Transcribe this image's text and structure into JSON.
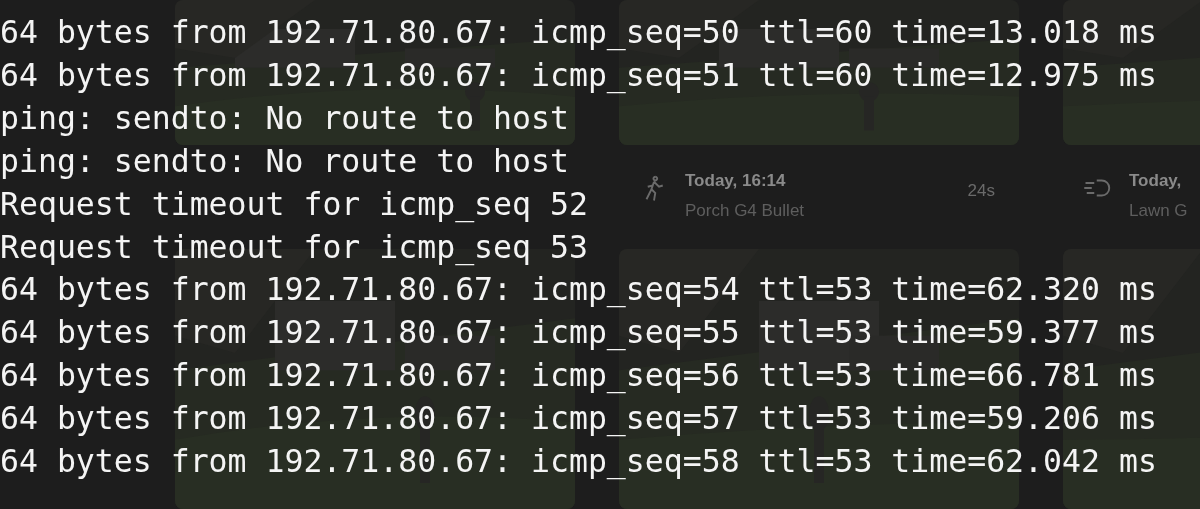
{
  "backdrop": {
    "cards": [
      {
        "kind": "picture"
      },
      {
        "kind": "person",
        "time": "Today, 16:14",
        "camera": "Porch G4 Bullet",
        "duration": "24s"
      },
      {
        "kind": "motion",
        "time": "Today,",
        "camera": "Lawn G"
      }
    ]
  },
  "terminal": {
    "lines": [
      "64 bytes from 192.71.80.67: icmp_seq=50 ttl=60 time=13.018 ms",
      "64 bytes from 192.71.80.67: icmp_seq=51 ttl=60 time=12.975 ms",
      "ping: sendto: No route to host",
      "ping: sendto: No route to host",
      "Request timeout for icmp_seq 52",
      "Request timeout for icmp_seq 53",
      "64 bytes from 192.71.80.67: icmp_seq=54 ttl=53 time=62.320 ms",
      "64 bytes from 192.71.80.67: icmp_seq=55 ttl=53 time=59.377 ms",
      "64 bytes from 192.71.80.67: icmp_seq=56 ttl=53 time=66.781 ms",
      "64 bytes from 192.71.80.67: icmp_seq=57 ttl=53 time=59.206 ms",
      "64 bytes from 192.71.80.67: icmp_seq=58 ttl=53 time=62.042 ms"
    ]
  }
}
